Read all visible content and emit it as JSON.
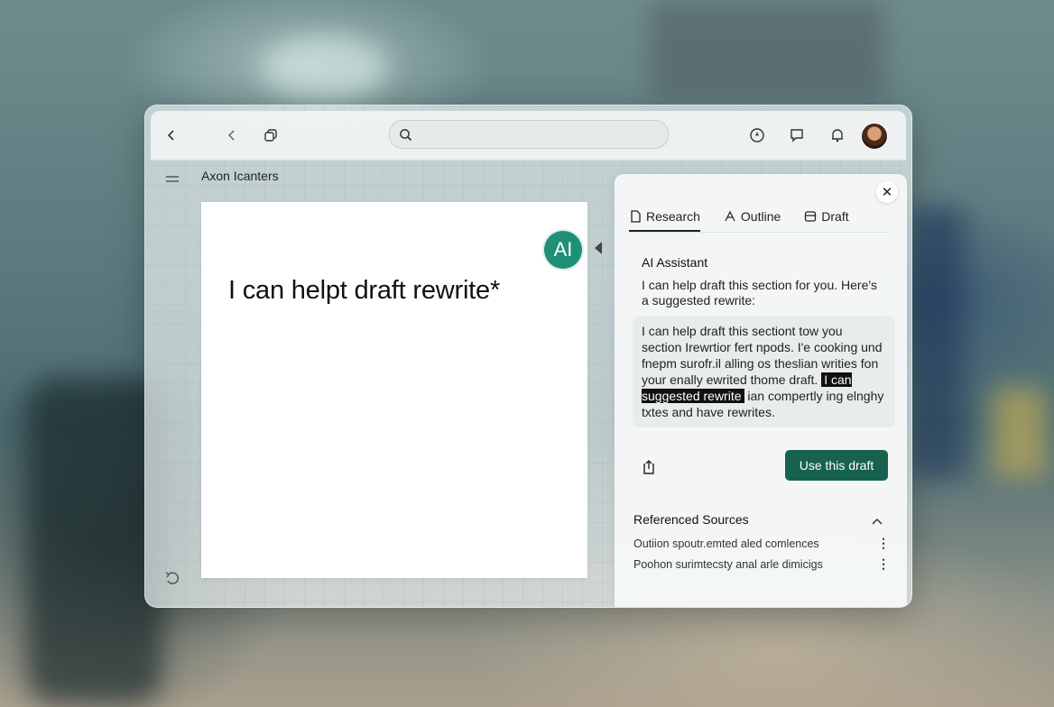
{
  "toolbar": {
    "search_placeholder": "",
    "icons": [
      "chevron-left-icon",
      "back-icon",
      "duplicate-icon",
      "search-icon",
      "compass-icon",
      "chat-icon",
      "bell-icon"
    ]
  },
  "document": {
    "title": "Axon Icanters",
    "heading": "I can helpt draft rewrite*"
  },
  "ai_badge": {
    "label": "AI"
  },
  "panel": {
    "tabs": [
      {
        "label": "Research",
        "active": true
      },
      {
        "label": "Outline",
        "active": false
      },
      {
        "label": "Draft",
        "active": false
      }
    ],
    "assistant_title": "AI Assistant",
    "assistant_intro": "I can help draft this section for you. Here's a suggested rewrite:",
    "suggestion_before": "I can help draft this sectiont tow you section Irewrtior fert npods. I'e cooking und fnepm surofr.il alling os theslian writies fon your enally ewrited thome draft.",
    "suggestion_highlight": "I can suggested rewrite",
    "suggestion_after": "ian compertly ing elnghy txtes and have rewrites.",
    "use_draft_label": "Use this draft",
    "sources_title": "Referenced Sources",
    "sources": [
      {
        "label": "Outiion spoutr.emted aled comlences"
      },
      {
        "label": "Poohon surimtecsty anal arle dimicigs"
      }
    ]
  },
  "colors": {
    "accent": "#17614f",
    "ai_badge": "#1f8f78"
  }
}
